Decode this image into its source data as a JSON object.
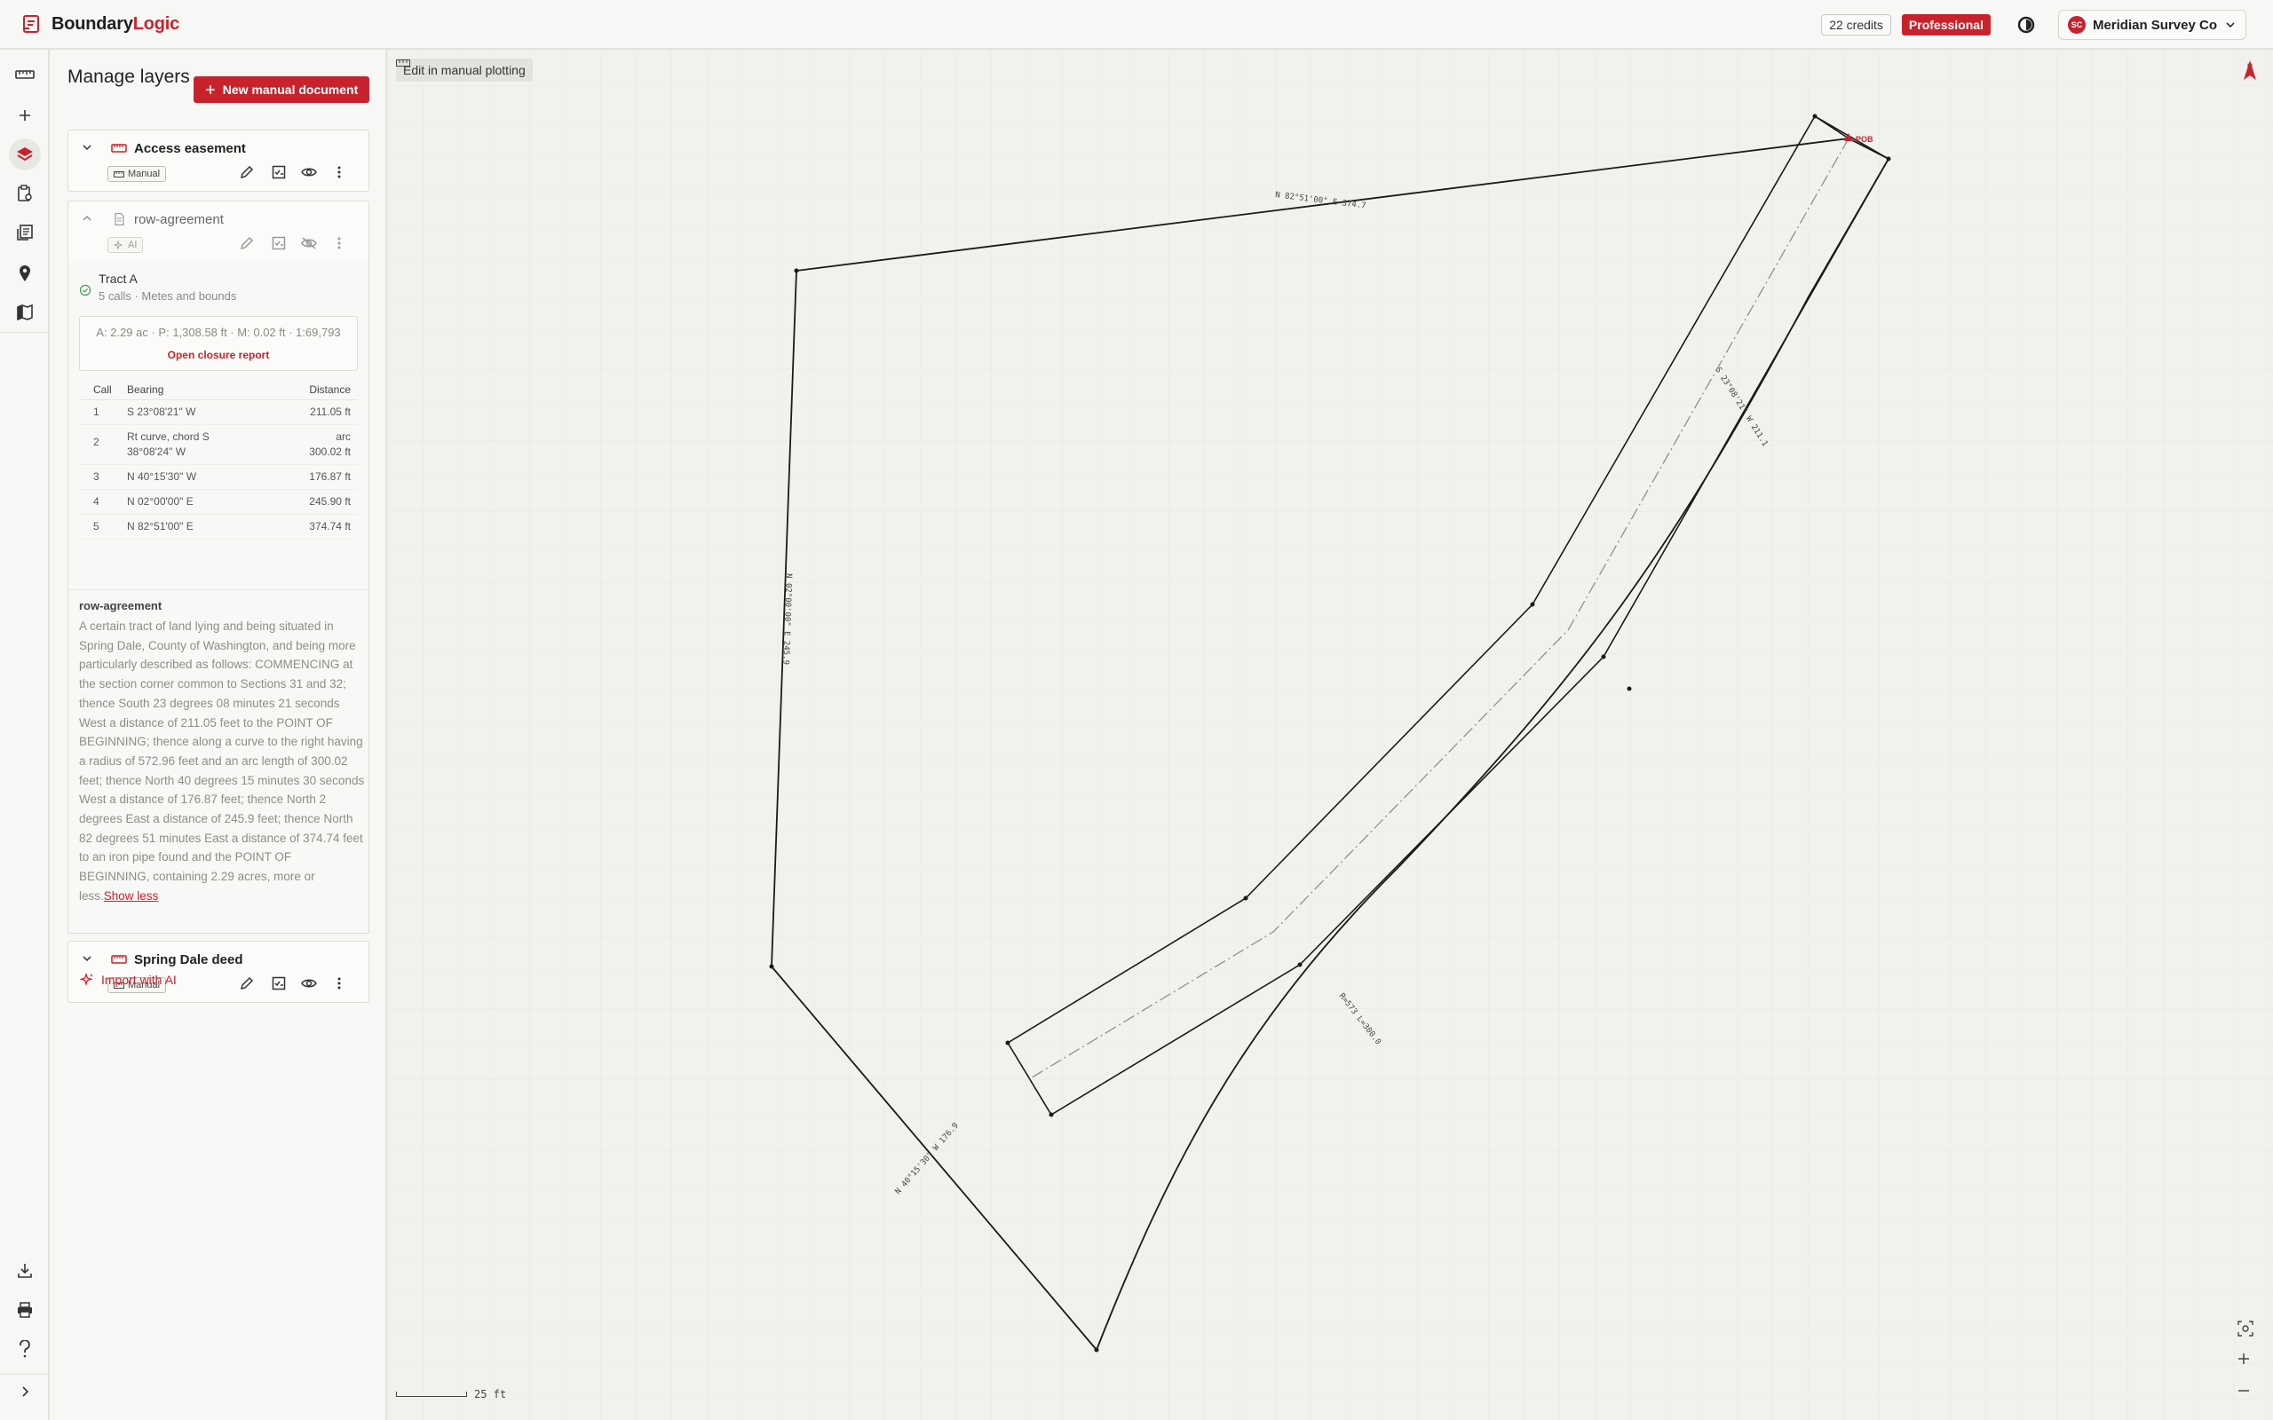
{
  "app": {
    "brand_part1": "Boundary",
    "brand_part2": "Logic"
  },
  "header": {
    "credits": "22 credits",
    "plan": "Professional",
    "org_initials": "SC",
    "org_name": "Meridian Survey Co"
  },
  "panel": {
    "title": "Manage layers",
    "new_button": "New manual document",
    "import_ai": "Import with AI"
  },
  "layers": [
    {
      "name": "Access easement",
      "badge": "Manual"
    },
    {
      "name": "row-agreement",
      "badge": "AI"
    },
    {
      "name": "Spring Dale deed",
      "badge": "Manual"
    }
  ],
  "tract": {
    "title": "Tract A",
    "subtitle": "5 calls · Metes and bounds",
    "metrics": "A: 2.29 ac · P: 1,308.58 ft · M: 0.02 ft · 1:69,793",
    "closure_link": "Open closure report",
    "columns": [
      "Call",
      "Bearing",
      "Distance"
    ],
    "calls": [
      {
        "call": "1",
        "bearing": "S 23°08'21\" W",
        "distance": "211.05 ft"
      },
      {
        "call": "2",
        "bearing": "Rt curve, chord S 38°08'24\" W",
        "distance": "arc 300.02 ft"
      },
      {
        "call": "3",
        "bearing": "N 40°15'30\" W",
        "distance": "176.87 ft"
      },
      {
        "call": "4",
        "bearing": "N 02°00'00\" E",
        "distance": "245.90 ft"
      },
      {
        "call": "5",
        "bearing": "N 82°51'00\" E",
        "distance": "374.74 ft"
      }
    ]
  },
  "description": {
    "title": "row-agreement",
    "text": "A certain tract of land lying and being situated in Spring Dale, County of Washington, and being more particularly described as follows: COMMENCING at the section corner common to Sections 31 and 32; thence South 23 degrees 08 minutes 21 seconds West a distance of 211.05 feet to the POINT OF BEGINNING; thence along a curve to the right having a radius of 572.96 feet and an arc length of 300.02 feet; thence North 40 degrees 15 minutes 30 seconds West a distance of 176.87 feet; thence North 2 degrees East a distance of 245.9 feet; thence North 82 degrees 51 minutes East a distance of 374.74 feet to an iron pipe found and the POINT OF BEGINNING, containing 2.29 acres, more or less.",
    "show_less": "Show less"
  },
  "map": {
    "edit_chip": "Edit in manual plotting",
    "north_label": "N",
    "scale_label": "25 ft",
    "pob_label": "POB",
    "labels": {
      "top": "N 82°51'00\" E 374.7",
      "left": "N 02°00'00\" E 245.9",
      "bottom_left": "N 40°15'30\" W 176.9",
      "right": "S 23°08'21\" W 211.1",
      "curve": "R=573 L=300.0"
    }
  },
  "colors": {
    "accent": "#c8232c",
    "line": "#1a1a1a"
  }
}
